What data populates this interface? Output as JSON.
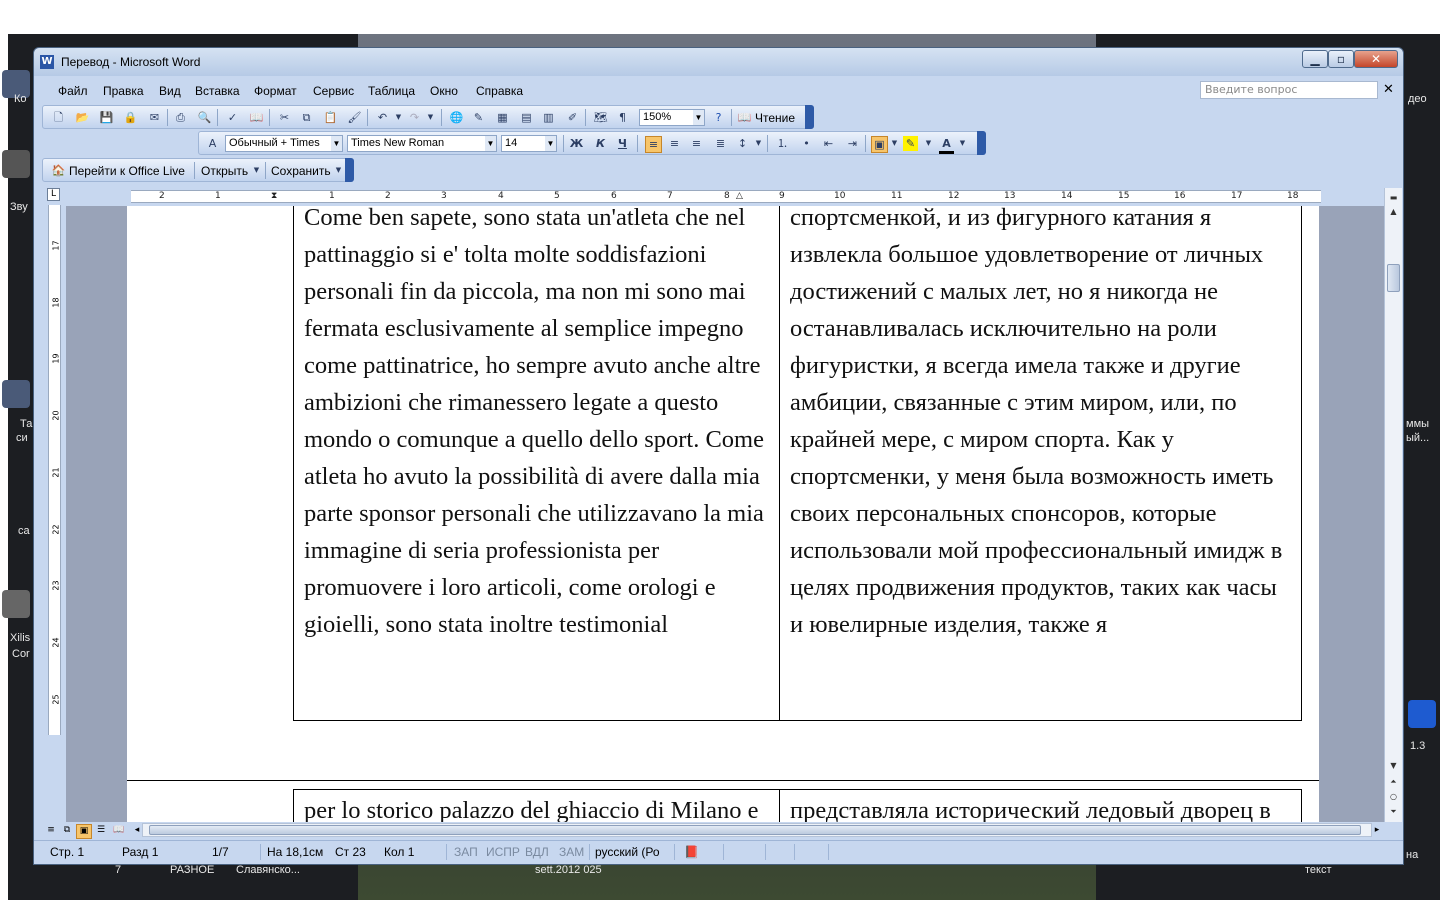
{
  "desktop": {
    "labels": [
      "Ко",
      "Зву",
      "Та",
      "си",
      "са",
      "Xilis",
      "Cor",
      "део",
      "ммы",
      "ый...",
      "1.3",
      "на",
      "РАЗНОЕ",
      "Славянско...",
      "sett.2012 025",
      "текст",
      "7"
    ]
  },
  "window": {
    "title": "Перевод - Microsoft Word",
    "icon": "W",
    "minimize_icon": "minimize-icon",
    "maximize_icon": "maximize-icon",
    "close_icon": "close-icon"
  },
  "menubar": {
    "items": [
      "Файл",
      "Правка",
      "Вид",
      "Вставка",
      "Формат",
      "Сервис",
      "Таблица",
      "Окно",
      "Справка"
    ],
    "help_placeholder": "Введите вопрос",
    "close_doc": "✕"
  },
  "standard_toolbar": {
    "zoom": "150%",
    "reading_label": "Чтение"
  },
  "format_toolbar": {
    "style": "Обычный + Times",
    "font": "Times New Roman",
    "size": "14",
    "bold": "Ж",
    "italic": "К",
    "underline": "Ч",
    "font_color": "A"
  },
  "office_toolbar": {
    "office_live": "Перейти к Office Live",
    "open": "Открыть",
    "save": "Сохранить"
  },
  "ruler": {
    "numbers": [
      "2",
      "1",
      "1",
      "1",
      "2",
      "3",
      "4",
      "5",
      "6",
      "7",
      "8",
      "9",
      "10",
      "11",
      "12",
      "13",
      "14",
      "15",
      "16",
      "17",
      "18"
    ]
  },
  "vruler": {
    "numbers": [
      "17",
      "18",
      "19",
      "20",
      "21",
      "22",
      "23",
      "24",
      "25"
    ]
  },
  "document": {
    "row1_left": "Come ben sapete, sono stata un'atleta che nel pattinaggio si e' tolta molte soddisfazioni personali fin da piccola, ma non mi sono mai fermata esclusivamente al semplice impegno come pattinatrice, ho sempre avuto anche altre ambizioni che rimanessero legate a questo mondo o comunque a quello dello sport. Come atleta ho avuto la possibilità di avere dalla mia parte sponsor personali che utilizzavano la mia immagine di seria professionista per promuovere i loro articoli, come orologi e gioielli, sono stata inoltre testimonial",
    "row1_right": "спортсменкой, и из фигурного катания я извлекла большое удовлетворение от личных достижений с малых лет, но я никогда не останавливалась исключительно на роли фигуристки, я всегда имела также и другие амбиции, связанные с этим миром, или, по крайней мере, с миром спорта. Как у спортсменки, у меня была возможность иметь своих персональных спонсоров, которые использовали мой профессиональный имидж в целях продвижения продуктов, таких как часы и ювелирные изделия, также я",
    "row2_left": "per lo storico palazzo del ghiaccio di Milano e la mia foto era su qualunque forma di pubblicità che lo riguardava",
    "row2_right": "представляла исторический ледовый дворец в Милане, моя фотография"
  },
  "statusbar": {
    "page": "Стр. 1",
    "section": "Разд 1",
    "pages": "1/7",
    "at": "На 18,1см",
    "line": "Ст 23",
    "col": "Кол 1",
    "rec": "ЗАП",
    "trk": "ИСПР",
    "ext": "ВДЛ",
    "ovr": "ЗАМ",
    "language": "русский (Ро"
  }
}
